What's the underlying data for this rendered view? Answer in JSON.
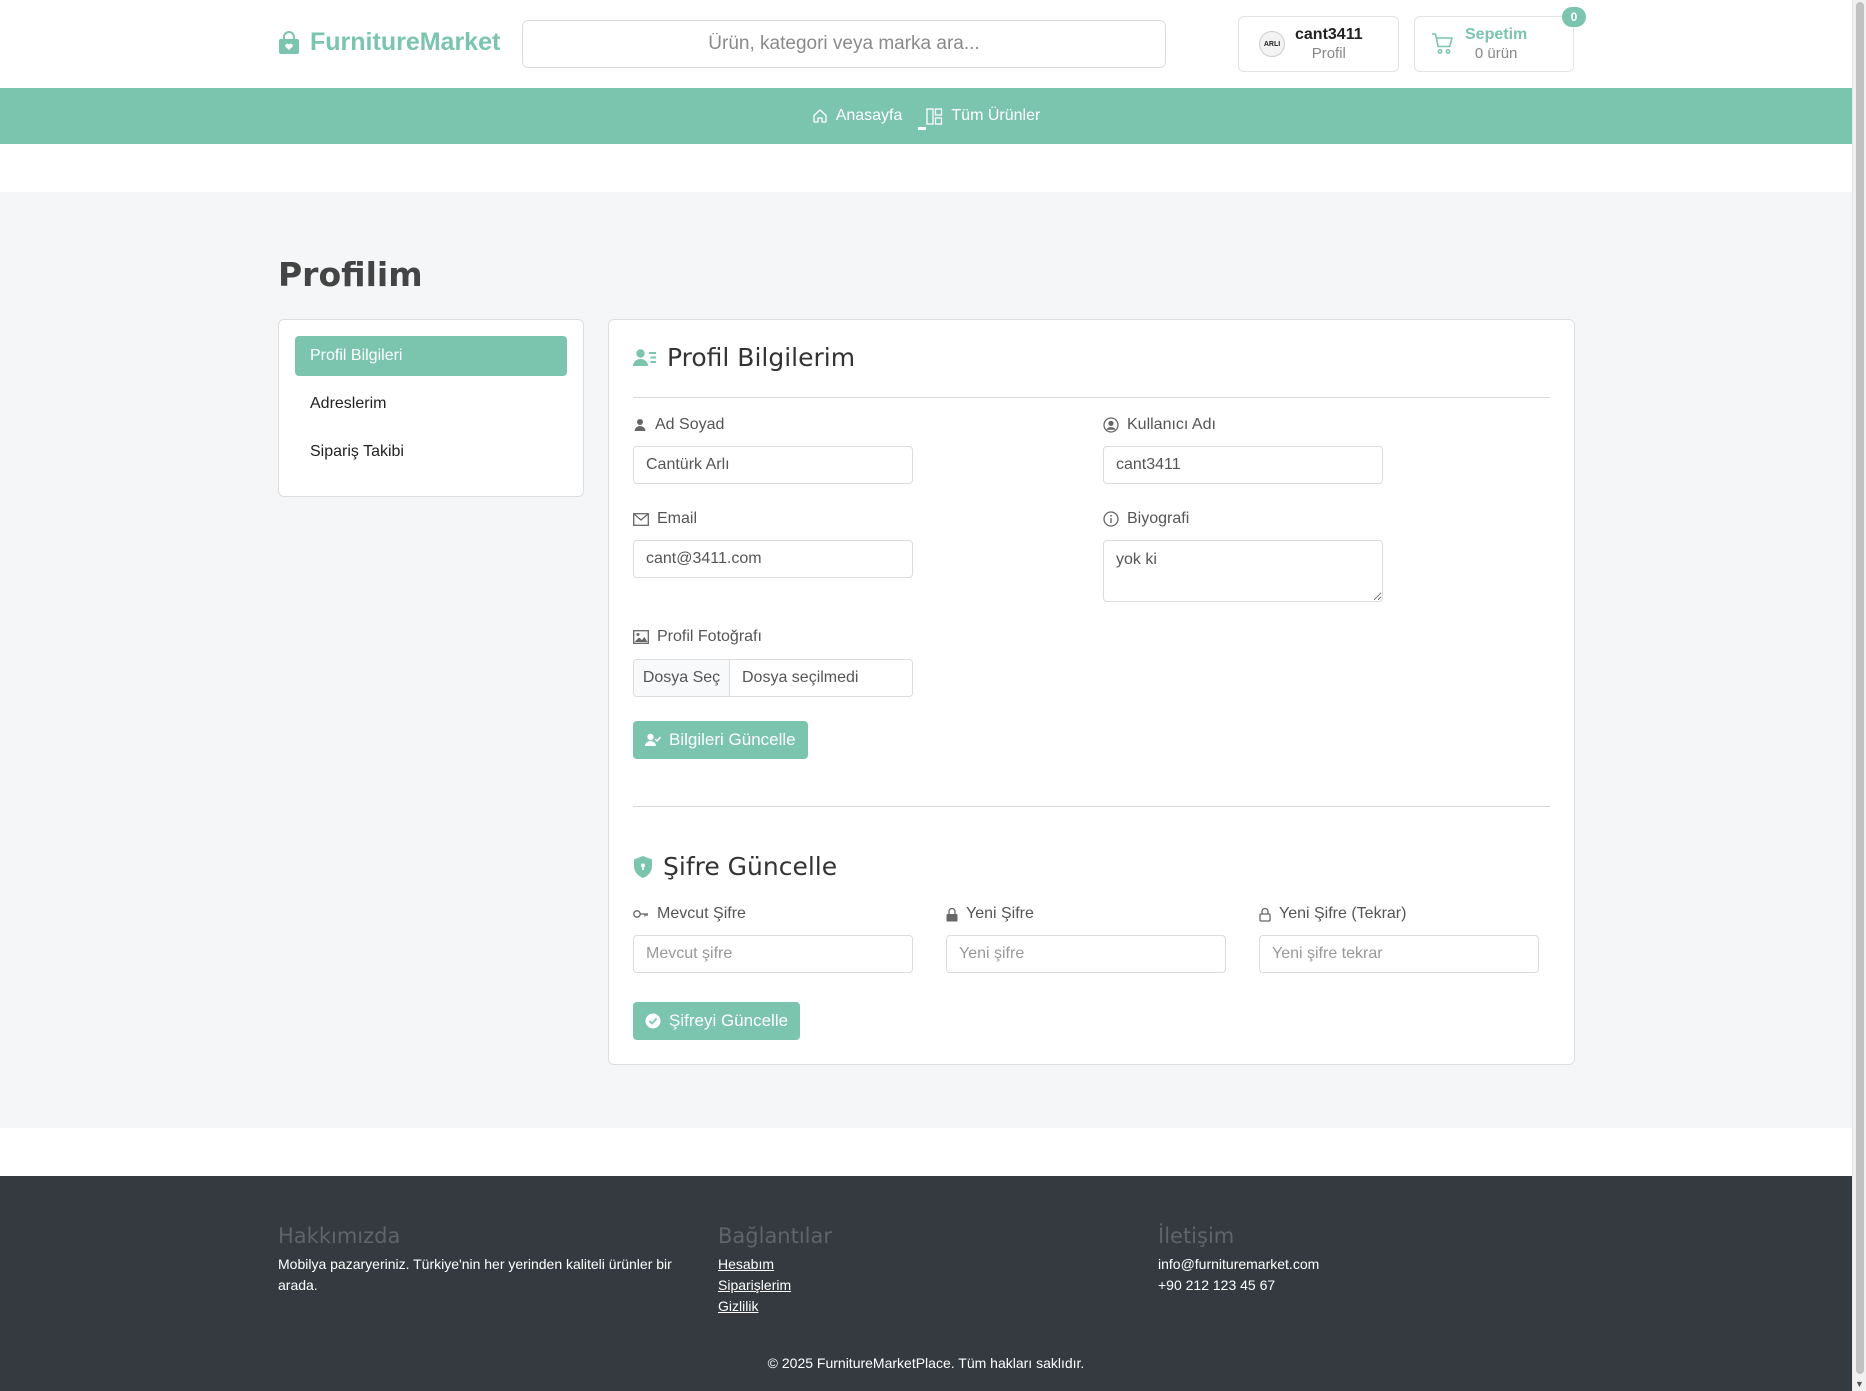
{
  "header": {
    "brand": "FurnitureMarket",
    "search_placeholder": "Ürün, kategori veya marka ara...",
    "profile": {
      "username": "cant3411",
      "subtitle": "Profil",
      "avatar_text": "ARLI"
    },
    "cart": {
      "title": "Sepetim",
      "subtitle": "0 ürün",
      "badge": "0"
    }
  },
  "nav": {
    "items": [
      {
        "label": "Anasayfa",
        "icon": "home-icon"
      },
      {
        "label": "Tüm Ürünler",
        "icon": "grid-icon"
      }
    ]
  },
  "page": {
    "title": "Profilim"
  },
  "sidebar": {
    "items": [
      {
        "label": "Profil Bilgileri",
        "active": true
      },
      {
        "label": "Adreslerim",
        "active": false
      },
      {
        "label": "Sipariş Takibi",
        "active": false
      }
    ]
  },
  "profile_form": {
    "title": "Profil Bilgilerim",
    "fullname": {
      "label": "Ad Soyad",
      "value": "Cantürk Arlı"
    },
    "username": {
      "label": "Kullanıcı Adı",
      "value": "cant3411"
    },
    "email": {
      "label": "Email",
      "value": "cant@3411.com"
    },
    "bio": {
      "label": "Biyografi",
      "value": "yok ki"
    },
    "photo": {
      "label": "Profil Fotoğrafı",
      "button": "Dosya Seç",
      "status": "Dosya seçilmedi"
    },
    "submit": "Bilgileri Güncelle"
  },
  "password_form": {
    "title": "Şifre Güncelle",
    "current": {
      "label": "Mevcut Şifre",
      "placeholder": "Mevcut şifre"
    },
    "new": {
      "label": "Yeni Şifre",
      "placeholder": "Yeni şifre"
    },
    "confirm": {
      "label": "Yeni Şifre (Tekrar)",
      "placeholder": "Yeni şifre tekrar"
    },
    "submit": "Şifreyi Güncelle"
  },
  "footer": {
    "about": {
      "heading": "Hakkımızda",
      "text": "Mobilya pazaryeriniz. Türkiye'nin her yerinden kaliteli ürünler bir arada."
    },
    "links": {
      "heading": "Bağlantılar",
      "items": [
        "Hesabım",
        "Siparişlerim",
        "Gizlilik"
      ]
    },
    "contact": {
      "heading": "İletişim",
      "email": "info@furnituremarket.com",
      "phone": "+90 212 123 45 67"
    },
    "copyright": "© 2025 FurnitureMarketPlace. Tüm hakları saklıdır."
  },
  "colors": {
    "accent": "#7bc4ad",
    "footer_bg": "#343a40",
    "page_bg": "#f5f6f7"
  }
}
